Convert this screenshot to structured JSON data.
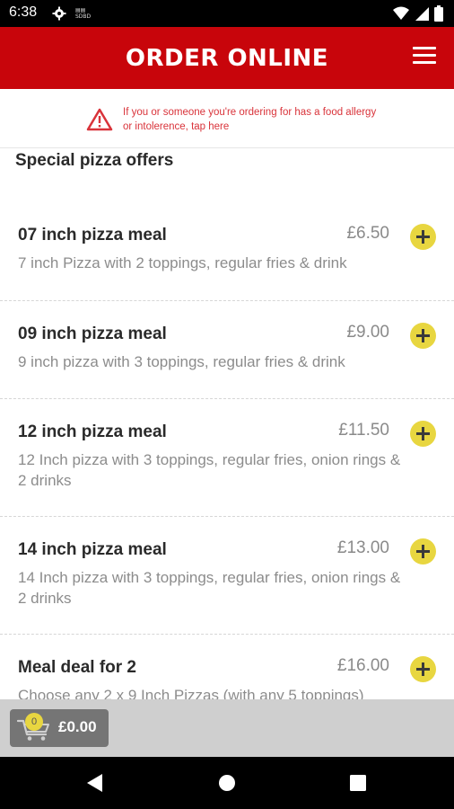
{
  "status_bar": {
    "time": "6:38",
    "mini_text_1": "▤▤",
    "mini_text_2": "SDBD"
  },
  "header": {
    "title": "ORDER ONLINE"
  },
  "allergy": {
    "text": "If you or someone you're ordering for has a food allergy or intolerence, tap here"
  },
  "section": {
    "title": "Special pizza offers"
  },
  "items": [
    {
      "name": "07 inch pizza meal",
      "price": "£6.50",
      "description": "7 inch Pizza with 2 toppings, regular fries & drink"
    },
    {
      "name": "09 inch pizza meal",
      "price": "£9.00",
      "description": "9 inch pizza with 3 toppings, regular fries & drink"
    },
    {
      "name": "12 inch pizza meal",
      "price": "£11.50",
      "description": "12 Inch pizza with 3 toppings, regular fries, onion rings & 2 drinks"
    },
    {
      "name": "14 inch pizza meal",
      "price": "£13.00",
      "description": "14 Inch pizza with 3 toppings, regular fries, onion rings & 2 drinks"
    },
    {
      "name": "Meal deal for 2",
      "price": "£16.00",
      "description": "Choose any 2 x 9 Inch Pizzas (with any 5 toppings)"
    }
  ],
  "cart": {
    "count": "0",
    "total": "£0.00"
  },
  "colors": {
    "brand_red": "#c8050b",
    "add_yellow": "#e8d640",
    "warning_red": "#d9333a"
  },
  "icons": {
    "menu": "hamburger-icon",
    "warning": "warning-triangle-icon",
    "add": "plus-icon",
    "cart": "shopping-cart-icon"
  }
}
